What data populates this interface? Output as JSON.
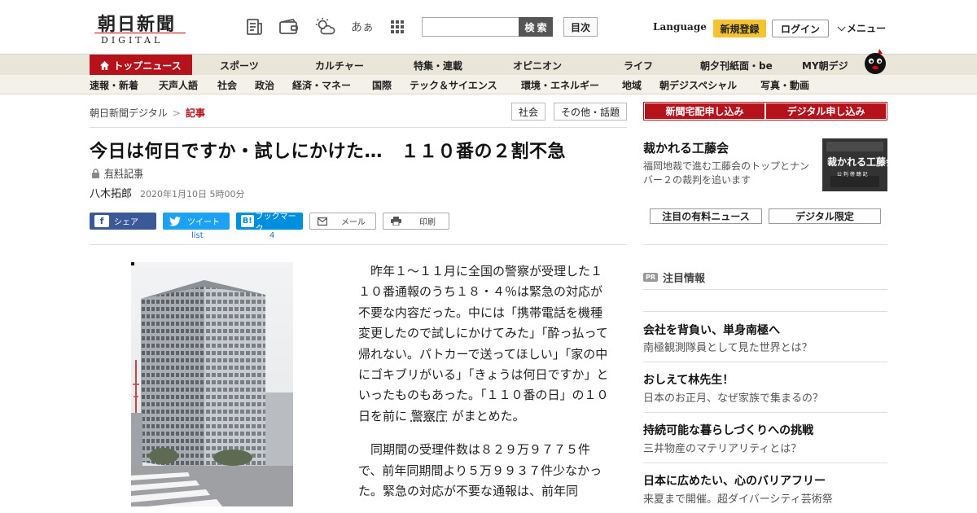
{
  "header": {
    "logo_jp": "朝日新聞",
    "logo_en": "DIGITAL",
    "icons": [
      "newspaper-icon",
      "wallet-icon",
      "weather-icon",
      "font-size-icon",
      "apps-grid-icon"
    ],
    "font_size_label": "あぁ",
    "search": {
      "placeholder": "",
      "button": "検 索"
    },
    "toc": "目次",
    "language": "Language",
    "signup": "新規登録",
    "login": "ログイン",
    "menu": "メニュー"
  },
  "nav_primary": [
    "トップニュース",
    "スポーツ",
    "カルチャー",
    "特集・連載",
    "オピニオン",
    "ライフ",
    "朝夕刊紙面・be",
    "MY朝デジ"
  ],
  "nav_secondary": [
    "速報・新着",
    "天声人語",
    "社会",
    "政治",
    "経済・マネー",
    "国際",
    "テック＆サイエンス",
    "環境・エネルギー",
    "地域",
    "朝デジスペシャル",
    "写真・動画"
  ],
  "breadcrumb": {
    "home": "朝日新聞デジタル",
    "sep": ">",
    "current": "記事"
  },
  "tags": [
    "社会",
    "その他・話題"
  ],
  "article": {
    "title": "今日は何日ですか・試しにかけた…　１１０番の２割不急",
    "paid_label": "有料記事",
    "author": "八木拓郎",
    "date": "2020年1月10日 5時00分",
    "share": {
      "facebook": "シェア",
      "twitter": "ツイート",
      "twitter_count": "list",
      "hatena": "ブックマーク",
      "hatena_count": "4",
      "mail": "メール",
      "print": "印刷"
    },
    "p1_a": "昨年１～１１月に全国の警察が受理した１１０番通報のうち１８・４％は緊急の対応が不要な内容だった。中には「携帯電話を機種変更したので試しにかけてみた」「酔っ払って帰れない。パトカーで送ってほしい」「家の中にゴキブリがいる」「きょうは何日ですか」といったものもあった。「１１０番の日」の１０日を前に",
    "p1_link": "警察庁",
    "p1_b": "がまとめた。",
    "p2": "同期間の受理件数は８２９万９７７５件で、前年同期間より５万９９３７件少なかった。緊急の対応が不要な通報は、前年同"
  },
  "sidebar": {
    "buttons": [
      "新聞宅配申し込み",
      "デジタル申し込み"
    ],
    "feature": {
      "title": "裁かれる工藤会",
      "desc": "福岡地裁で進む工藤会のトップとナンバー２の裁判を追います",
      "img_title": "裁かれる工藤会",
      "img_sub": "公 判 傍 聴 記"
    },
    "tabs": [
      "注目の有料ニュース",
      "デジタル限定"
    ],
    "pr_badge": "PR",
    "pr_heading": "注目情報",
    "pr_items": [
      {
        "title": "会社を背負い、単身南極へ",
        "desc": "南極観測隊員として見た世界とは？"
      },
      {
        "title": "おしえて林先生！",
        "desc": "日本のお正月、なぜ家族で集まるの？"
      },
      {
        "title": "持続可能な暮らしづくりへの挑戦",
        "desc": "三井物産のマテリアリティとは？"
      },
      {
        "title": "日本に広めたい、心のバリアフリー",
        "desc": "来夏まで開催。超ダイバーシティ芸術祭"
      }
    ]
  },
  "colors": {
    "brand_red": "#b5121b",
    "nav_bg": "#e9e5d9",
    "signup_yellow": "#f5c330"
  }
}
